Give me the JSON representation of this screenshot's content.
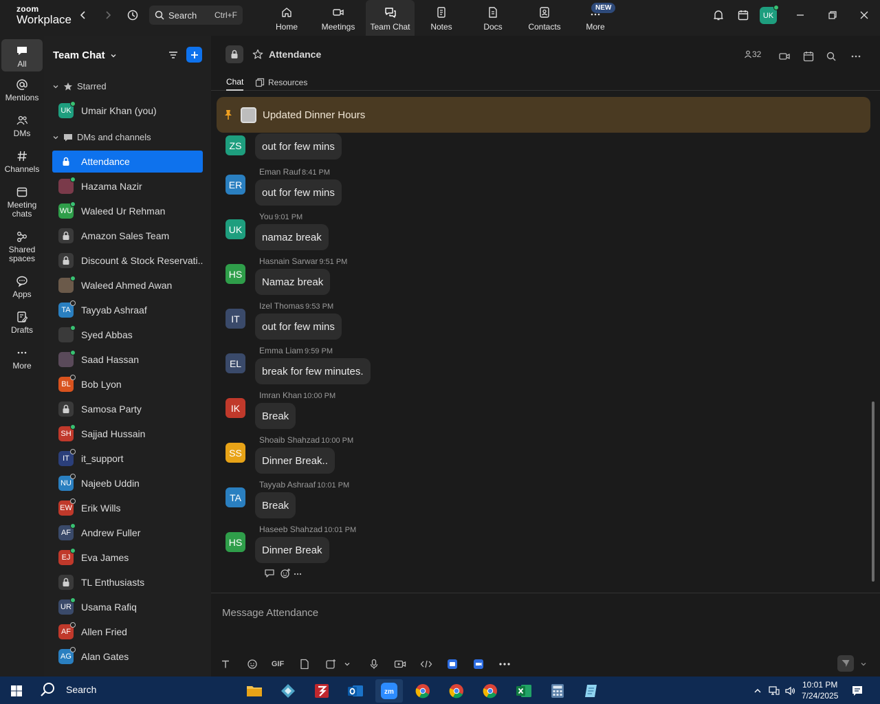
{
  "app": {
    "logo_line1": "zoom",
    "logo_line2": "Workplace"
  },
  "titlebar": {
    "search_label": "Search",
    "search_shortcut": "Ctrl+F",
    "tabs": [
      {
        "label": "Home",
        "icon": "home-icon"
      },
      {
        "label": "Meetings",
        "icon": "video-camera-icon"
      },
      {
        "label": "Team Chat",
        "icon": "chat-bubbles-icon",
        "active": true
      },
      {
        "label": "Notes",
        "icon": "notes-icon"
      },
      {
        "label": "Docs",
        "icon": "docs-icon"
      },
      {
        "label": "Contacts",
        "icon": "contacts-icon"
      },
      {
        "label": "More",
        "icon": "more-dots-icon"
      }
    ],
    "new_badge": "NEW",
    "user_initials": "UK"
  },
  "rail": {
    "items": [
      {
        "label": "All",
        "icon": "chat-icon",
        "active": true
      },
      {
        "label": "Mentions",
        "icon": "at-icon"
      },
      {
        "label": "DMs",
        "icon": "people-icon"
      },
      {
        "label": "Channels",
        "icon": "hash-icon"
      },
      {
        "label": "Meeting chats",
        "icon": "calendar-icon"
      },
      {
        "label": "Shared spaces",
        "icon": "share-icon"
      },
      {
        "label": "Apps",
        "icon": "apps-icon"
      },
      {
        "label": "Drafts",
        "icon": "draft-icon"
      },
      {
        "label": "More",
        "icon": "more-dots-icon"
      }
    ]
  },
  "panel": {
    "title": "Team Chat",
    "sections": {
      "starred": "Starred",
      "dms": "DMs and channels"
    },
    "starred": [
      {
        "initials": "UK",
        "name": "Umair Khan (you)",
        "color": "#1e9e7e",
        "status": "on"
      }
    ],
    "chats": [
      {
        "type": "lock",
        "name": "Attendance",
        "active": true
      },
      {
        "type": "photo",
        "initials": "",
        "name": "Hazama Nazir",
        "color": "#7a3a4a",
        "status": "on"
      },
      {
        "type": "avatar",
        "initials": "WU",
        "name": "Waleed Ur Rehman",
        "color": "#2f9e4a",
        "status": "on"
      },
      {
        "type": "lock",
        "name": "Amazon Sales Team"
      },
      {
        "type": "lock",
        "name": "Discount & Stock Reservati..."
      },
      {
        "type": "photo",
        "initials": "",
        "name": "Waleed Ahmed Awan",
        "color": "#6b5a4a",
        "status": "on"
      },
      {
        "type": "avatar",
        "initials": "TA",
        "name": "Tayyab Ashraaf",
        "color": "#2a7fc0",
        "status": "off"
      },
      {
        "type": "photo",
        "initials": "",
        "name": "Syed Abbas",
        "color": "#3a3a3a",
        "status": "on"
      },
      {
        "type": "photo",
        "initials": "",
        "name": "Saad Hassan",
        "color": "#5a4a5a",
        "status": "on"
      },
      {
        "type": "avatar",
        "initials": "BL",
        "name": "Bob Lyon",
        "color": "#d9531e",
        "status": "off"
      },
      {
        "type": "lock",
        "name": "Samosa Party"
      },
      {
        "type": "avatar",
        "initials": "SH",
        "name": "Sajjad Hussain",
        "color": "#c0392b",
        "status": "on"
      },
      {
        "type": "photo",
        "initials": "IT",
        "name": "it_support",
        "color": "#2b3f7a",
        "status": "off"
      },
      {
        "type": "avatar",
        "initials": "NU",
        "name": "Najeeb Uddin",
        "color": "#2a7fc0",
        "status": "off"
      },
      {
        "type": "avatar",
        "initials": "EW",
        "name": "Erik Wills",
        "color": "#c0392b",
        "status": "off"
      },
      {
        "type": "avatar",
        "initials": "AF",
        "name": "Andrew Fuller",
        "color": "#3a4a6a",
        "status": "on"
      },
      {
        "type": "avatar",
        "initials": "EJ",
        "name": "Eva James",
        "color": "#c0392b",
        "status": "on"
      },
      {
        "type": "lock",
        "name": "TL Enthusiasts"
      },
      {
        "type": "avatar",
        "initials": "UR",
        "name": "Usama Rafiq",
        "color": "#3a4a6a",
        "status": "on"
      },
      {
        "type": "avatar",
        "initials": "AF",
        "name": "Allen Fried",
        "color": "#c0392b",
        "status": "off"
      },
      {
        "type": "avatar",
        "initials": "AG",
        "name": "Alan Gates",
        "color": "#2a7fc0",
        "status": "off"
      }
    ]
  },
  "channel": {
    "title": "Attendance",
    "member_count": "32",
    "tabs": {
      "chat": "Chat",
      "resources": "Resources"
    },
    "pinned": "Updated Dinner Hours",
    "composer_placeholder": "Message Attendance",
    "gif_label": "GIF"
  },
  "messages": [
    {
      "initials": "ZS",
      "name": "",
      "time": "",
      "text": "out for few mins",
      "color": "#1e9e7e"
    },
    {
      "initials": "ER",
      "name": "Eman Rauf",
      "time": "8:41 PM",
      "text": "out for few mins",
      "color": "#2a7fc0"
    },
    {
      "initials": "UK",
      "name": "You",
      "time": "9:01 PM",
      "text": "namaz break",
      "color": "#1e9e7e"
    },
    {
      "initials": "HS",
      "name": "Hasnain Sarwar",
      "time": "9:51 PM",
      "text": "Namaz break",
      "color": "#2f9e4a"
    },
    {
      "initials": "IT",
      "name": "Izel Thomas",
      "time": "9:53 PM",
      "text": "out for few mins",
      "color": "#3a4a6a"
    },
    {
      "initials": "EL",
      "name": "Emma Liam",
      "time": "9:59 PM",
      "text": "break for few minutes.",
      "color": "#3a4a6a"
    },
    {
      "initials": "IK",
      "name": "Imran Khan",
      "time": "10:00 PM",
      "text": "Break",
      "color": "#c0392b"
    },
    {
      "initials": "SS",
      "name": "Shoaib Shahzad",
      "time": "10:00 PM",
      "text": "Dinner Break..",
      "color": "#e8a317"
    },
    {
      "initials": "TA",
      "name": "Tayyab Ashraaf",
      "time": "10:01 PM",
      "text": "Break",
      "color": "#2a7fc0"
    },
    {
      "initials": "HS",
      "name": "Haseeb Shahzad",
      "time": "10:01 PM",
      "text": "Dinner Break",
      "color": "#2f9e4a"
    }
  ],
  "taskbar": {
    "search_label": "Search",
    "time": "10:01 PM",
    "date": "7/24/2025",
    "apps": [
      "file-explorer-icon",
      "app-icon",
      "filezilla-icon",
      "outlook-icon",
      "zoom-icon",
      "chrome-icon",
      "chrome-icon",
      "chrome-icon",
      "excel-icon",
      "calculator-icon",
      "notepad-icon"
    ]
  }
}
